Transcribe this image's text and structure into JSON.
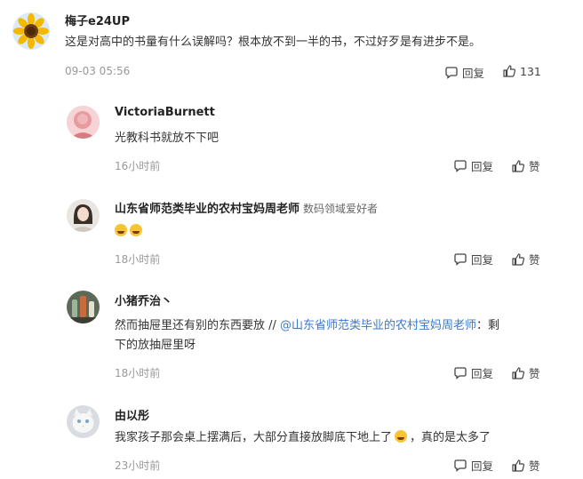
{
  "top": {
    "username": "梅子e24UP",
    "text": "这是对高中的书量有什么误解吗？根本放不到一半的书，不过好歹是有进步不是。",
    "time": "09-03 05:56",
    "reply_label": "回复",
    "like_count": "131"
  },
  "replies": [
    {
      "username": "VictoriaBurnett",
      "text": "光教科书就放不下吧",
      "time": "16小时前",
      "reply_label": "回复",
      "like_label": "赞"
    },
    {
      "username": "山东省师范类毕业的农村宝妈周老师",
      "badge": "数码领域爱好者",
      "time": "18小时前",
      "reply_label": "回复",
      "like_label": "赞"
    },
    {
      "username": "小猪乔治丶",
      "text_prefix": "然而抽屉里还有别的东西要放 // ",
      "mention": "@山东省师范类毕业的农村宝妈周老师",
      "text_suffix": "：剩",
      "text_line2": "下的放抽屉里呀",
      "time": "18小时前",
      "reply_label": "回复",
      "like_label": "赞"
    },
    {
      "username": "由以彤",
      "text_prefix": "我家孩子那会桌上摆满后，大部分直接放脚底下地上了",
      "text_suffix": "，真的是太多了",
      "time": "23小时前",
      "reply_label": "回复",
      "like_label": "赞"
    }
  ],
  "icons": {
    "reply": "speech-bubble-icon",
    "like": "thumbs-up-icon",
    "emoji": "laughing-emoji-icon"
  },
  "colors": {
    "mention": "#3d79c7",
    "meta": "#999999"
  }
}
